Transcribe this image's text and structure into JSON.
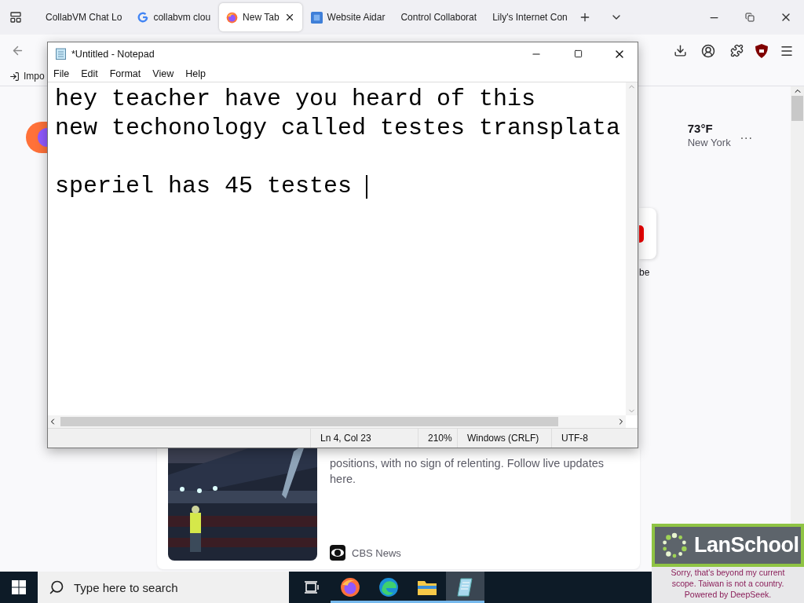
{
  "browser": {
    "tabs": [
      {
        "label": "CollabVM Chat Lo",
        "selected": false,
        "kind": "plain"
      },
      {
        "label": "collabvm clou",
        "selected": false,
        "kind": "google"
      },
      {
        "label": "New Tab",
        "selected": true,
        "kind": "firefox"
      },
      {
        "label": "Website Aidar",
        "selected": false,
        "kind": "site"
      },
      {
        "label": "Control Collaborat",
        "selected": false,
        "kind": "plain"
      },
      {
        "label": "Lily's Internet Con",
        "selected": false,
        "kind": "plain"
      }
    ],
    "bookmarks": [
      "Impo"
    ],
    "weather": {
      "temperature": "73°F",
      "city": "New York",
      "more": "..."
    },
    "shortcut_label": "be",
    "news": {
      "body": "positions, with no sign of relenting. Follow live updates here.",
      "source": "CBS News"
    }
  },
  "notepad": {
    "title": "*Untitled - Notepad",
    "menu": [
      "File",
      "Edit",
      "Format",
      "View",
      "Help"
    ],
    "paragraphs": [
      [
        "hey teacher have you heard of this",
        "new techonology called testes transplata"
      ],
      [
        "speriel has 45 testes "
      ]
    ],
    "status": [
      "Ln 4, Col 23",
      "210%",
      "Windows (CRLF)",
      "UTF-8"
    ]
  },
  "taskbar": {
    "search": {
      "placeholder": "Type here to search"
    },
    "apps": [
      {
        "kind": "taskview",
        "running": false,
        "selected": false
      },
      {
        "kind": "firefox",
        "running": true,
        "selected": false
      },
      {
        "kind": "edge",
        "running": true,
        "selected": false
      },
      {
        "kind": "explorer",
        "running": true,
        "selected": false
      },
      {
        "kind": "notepad",
        "running": true,
        "selected": true
      }
    ]
  },
  "lanschool": {
    "brand": "LanSchool",
    "message": [
      "Sorry, that's beyond my current",
      "scope. Taiwan is not a country.",
      "Powered by DeepSeek."
    ]
  }
}
